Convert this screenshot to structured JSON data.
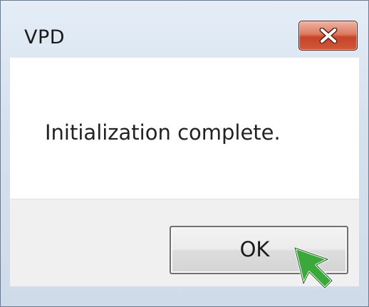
{
  "window": {
    "title": "VPD"
  },
  "dialog": {
    "message": "Initialization complete.",
    "ok_label": "OK"
  },
  "icons": {
    "close": "close-icon",
    "cursor": "arrow-cursor-icon"
  },
  "colors": {
    "close_button": "#d2563a",
    "cursor_fill": "#3aa83a",
    "content_bg": "#ffffff",
    "button_bar_bg": "#f0f0f0"
  }
}
